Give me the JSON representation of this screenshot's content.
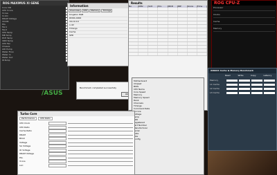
{
  "desktop": {
    "bg": "#1a1410"
  },
  "rog_window": {
    "title": "ROG MAXIMUS XI GENE",
    "items": [
      "Core VID",
      "CPU Vcore",
      "Vccsa",
      "VccIO",
      "DRAM Voltage",
      "VCCIN",
      "PLL",
      "Fan1",
      "Fan2",
      "CPU Temp",
      "MB Temp",
      "PCH Temp",
      "VRM Temp",
      "CPU Fan",
      "Chassis",
      "AIO Pump",
      "Water Flow",
      "Water In",
      "Water Out",
      "W.Temp"
    ]
  },
  "main_window": {
    "title": "Information",
    "tabs": [
      "Overview",
      "CPU",
      "Memory",
      "Timings"
    ],
    "list": [
      "Kingston 8GB",
      "DDR4-4000",
      "16-19-19",
      "1.4V",
      "Timings",
      "Cache",
      "SPD"
    ]
  },
  "spreadsheet": {
    "title": "Results",
    "cols": [
      "No",
      "MHz",
      "Volt",
      "tCL",
      "tRCD",
      "tRP",
      "Score",
      "Time"
    ],
    "rows": 14
  },
  "summary_window": {
    "rows": [
      "Motherboard",
      "Chipset",
      "BIOS",
      "CPU Name",
      "Core Speed",
      "Memory",
      "Memory Speed",
      "Rank",
      "Channels",
      "Timings",
      "Command Rate",
      "Uncore",
      "Voltage",
      "Temp",
      "SPD",
      "Registered",
      "Part Number",
      "Manufacturer",
      "Serial",
      "Date",
      "Size",
      "Config"
    ]
  },
  "bottom_window": {
    "title": "Turbo Core",
    "tabs": [
      "Performance",
      "CPU Ratio"
    ],
    "rows": [
      "CPU Clock",
      "CPU Ratio",
      "Cache Ratio",
      "DRAM",
      "BCLK",
      "Voltage",
      "SA Voltage",
      "IO Voltage",
      "DRAM Voltage",
      "PLL",
      "Vcore",
      "LLC"
    ]
  },
  "cpuz": {
    "title": "ROG CPU-Z",
    "labels": [
      "Processor",
      "Clocks",
      "Cache",
      "Memory"
    ]
  },
  "aida": {
    "title": "AIDA64 Cache & Memory Benchmark",
    "cols": [
      "Read",
      "Write",
      "Copy",
      "Latency"
    ],
    "rows": [
      "Memory",
      "L1 Cache",
      "L2 Cache",
      "L3 Cache"
    ]
  },
  "dialog": {
    "text": "Benchmark completed successfully",
    "ok": "OK"
  }
}
